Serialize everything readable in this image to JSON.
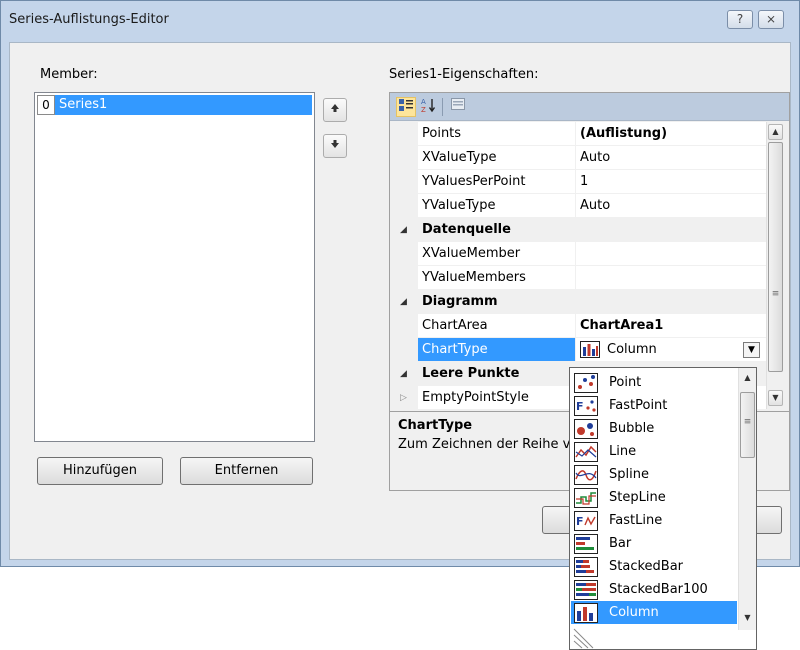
{
  "window": {
    "title": "Series-Auflistungs-Editor",
    "help_label": "?",
    "close_label": "⨯"
  },
  "member": {
    "label": "Member:",
    "items": [
      {
        "index": "0",
        "name": "Series1"
      }
    ],
    "up_icon": "arrow-up-icon",
    "down_icon": "arrow-down-icon",
    "add_label": "Hinzufügen",
    "remove_label": "Entfernen"
  },
  "properties": {
    "label": "Series1-Eigenschaften:",
    "toolbar": {
      "categorized_icon": "categorized-icon",
      "alphabetical_icon": "alphabetical-icon",
      "pages_icon": "property-pages-icon"
    },
    "rows": [
      {
        "name": "Points",
        "value": "(Auflistung)"
      },
      {
        "name": "XValueType",
        "value": "Auto"
      },
      {
        "name": "YValuesPerPoint",
        "value": "1"
      },
      {
        "name": "YValueType",
        "value": "Auto"
      },
      {
        "category": "Datenquelle"
      },
      {
        "name": "XValueMember",
        "value": ""
      },
      {
        "name": "YValueMembers",
        "value": ""
      },
      {
        "category": "Diagramm"
      },
      {
        "name": "ChartArea",
        "value": "ChartArea1"
      },
      {
        "name": "ChartType",
        "value": "Column"
      },
      {
        "category": "Leere Punkte"
      },
      {
        "name": "EmptyPointStyle",
        "value": ""
      }
    ],
    "help": {
      "title": "ChartType",
      "text": "Zum Zeichnen der Reihe v"
    }
  },
  "dropdown": {
    "items": [
      "Point",
      "FastPoint",
      "Bubble",
      "Line",
      "Spline",
      "StepLine",
      "FastLine",
      "Bar",
      "StackedBar",
      "StackedBar100",
      "Column"
    ],
    "selected": "Column"
  },
  "colors": {
    "selection": "#3399ff",
    "window_frame": "#c4d5ea",
    "toolbar": "#bccbde"
  }
}
